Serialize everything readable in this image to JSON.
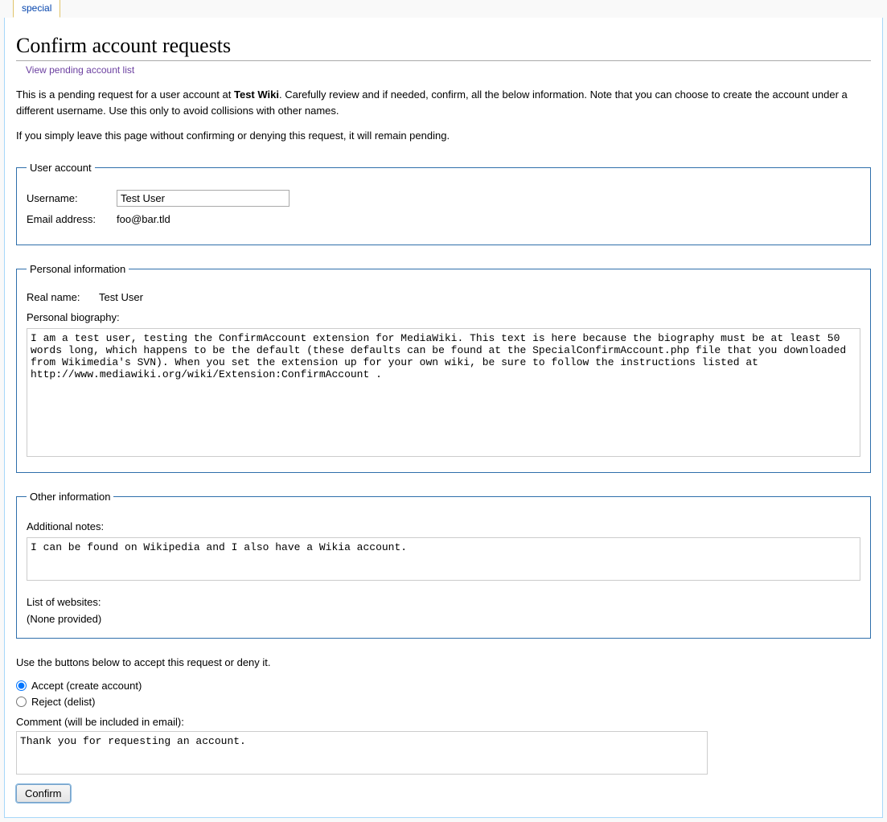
{
  "tab_label": "special",
  "page_title": "Confirm account requests",
  "view_pending_link": "View pending account list",
  "intro_prefix": "This is a pending request for a user account at ",
  "wiki_name": "Test Wiki",
  "intro_suffix": ". Carefully review and if needed, confirm, all the below information. Note that you can choose to create the account under a different username. Use this only to avoid collisions with other names.",
  "intro2": "If you simply leave this page without confirming or denying this request, it will remain pending.",
  "user_account": {
    "legend": "User account",
    "username_label": "Username:",
    "username_value": "Test User",
    "email_label": "Email address:",
    "email_value": "foo@bar.tld"
  },
  "personal": {
    "legend": "Personal information",
    "realname_label": "Real name:",
    "realname_value": "Test User",
    "bio_label": "Personal biography:",
    "bio_value": "I am a test user, testing the ConfirmAccount extension for MediaWiki. This text is here because the biography must be at least 50 words long, which happens to be the default (these defaults can be found at the SpecialConfirmAccount.php file that you downloaded from Wikimedia's SVN). When you set the extension up for your own wiki, be sure to follow the instructions listed at http://www.mediawiki.org/wiki/Extension:ConfirmAccount ."
  },
  "other": {
    "legend": "Other information",
    "notes_label": "Additional notes:",
    "notes_value": "I can be found on Wikipedia and I also have a Wikia account.",
    "websites_label": "List of websites:",
    "websites_value": "(None provided)"
  },
  "action": {
    "prompt": "Use the buttons below to accept this request or deny it.",
    "accept_label": "Accept (create account)",
    "reject_label": "Reject (delist)",
    "comment_label": "Comment (will be included in email):",
    "comment_value": "Thank you for requesting an account.",
    "confirm_button": "Confirm"
  }
}
